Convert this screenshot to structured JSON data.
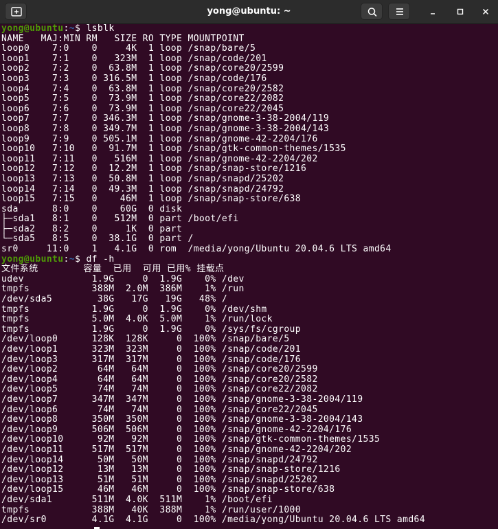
{
  "window": {
    "title": "yong@ubuntu: ~"
  },
  "icons": {
    "new_tab": "new-tab-icon",
    "search": "search-icon",
    "menu": "hamburger-menu-icon",
    "minimize": "minimize-icon",
    "maximize": "maximize-icon",
    "close": "close-icon"
  },
  "colors": {
    "background": "#300a24",
    "titlebar": "#2c2c2c",
    "prompt_user": "#4e9a06",
    "prompt_path": "#3465a4",
    "text": "#ffffff"
  },
  "terminal": {
    "prompt1": {
      "user_host": "yong@ubuntu",
      "sep": ":",
      "path": "~",
      "symbol": "$ ",
      "command": "lsblk"
    },
    "lsblk_lines": [
      "NAME   MAJ:MIN RM   SIZE RO TYPE MOUNTPOINT",
      "loop0    7:0    0     4K  1 loop /snap/bare/5",
      "loop1    7:1    0   323M  1 loop /snap/code/201",
      "loop2    7:2    0  63.8M  1 loop /snap/core20/2599",
      "loop3    7:3    0 316.5M  1 loop /snap/code/176",
      "loop4    7:4    0  63.8M  1 loop /snap/core20/2582",
      "loop5    7:5    0  73.9M  1 loop /snap/core22/2082",
      "loop6    7:6    0  73.9M  1 loop /snap/core22/2045",
      "loop7    7:7    0 346.3M  1 loop /snap/gnome-3-38-2004/119",
      "loop8    7:8    0 349.7M  1 loop /snap/gnome-3-38-2004/143",
      "loop9    7:9    0 505.1M  1 loop /snap/gnome-42-2204/176",
      "loop10   7:10   0  91.7M  1 loop /snap/gtk-common-themes/1535",
      "loop11   7:11   0   516M  1 loop /snap/gnome-42-2204/202",
      "loop12   7:12   0  12.2M  1 loop /snap/snap-store/1216",
      "loop13   7:13   0  50.8M  1 loop /snap/snapd/25202",
      "loop14   7:14   0  49.3M  1 loop /snap/snapd/24792",
      "loop15   7:15   0    46M  1 loop /snap/snap-store/638",
      "sda      8:0    0    60G  0 disk",
      "├─sda1   8:1    0   512M  0 part /boot/efi",
      "├─sda2   8:2    0     1K  0 part",
      "└─sda5   8:5    0  38.1G  0 part /",
      "sr0     11:0    1   4.1G  0 rom  /media/yong/Ubuntu 20.04.6 LTS amd64"
    ],
    "prompt2": {
      "user_host": "yong@ubuntu",
      "sep": ":",
      "path": "~",
      "symbol": "$ ",
      "command": "df -h"
    },
    "df_lines": [
      "文件系统        容量  已用  可用 已用% 挂载点",
      "udev            1.9G     0  1.9G    0% /dev",
      "tmpfs           388M  2.0M  386M    1% /run",
      "/dev/sda5        38G   17G   19G   48% /",
      "tmpfs           1.9G     0  1.9G    0% /dev/shm",
      "tmpfs           5.0M  4.0K  5.0M    1% /run/lock",
      "tmpfs           1.9G     0  1.9G    0% /sys/fs/cgroup",
      "/dev/loop0      128K  128K     0  100% /snap/bare/5",
      "/dev/loop1      323M  323M     0  100% /snap/code/201",
      "/dev/loop3      317M  317M     0  100% /snap/code/176",
      "/dev/loop2       64M   64M     0  100% /snap/core20/2599",
      "/dev/loop4       64M   64M     0  100% /snap/core20/2582",
      "/dev/loop5       74M   74M     0  100% /snap/core22/2082",
      "/dev/loop7      347M  347M     0  100% /snap/gnome-3-38-2004/119",
      "/dev/loop6       74M   74M     0  100% /snap/core22/2045",
      "/dev/loop8      350M  350M     0  100% /snap/gnome-3-38-2004/143",
      "/dev/loop9      506M  506M     0  100% /snap/gnome-42-2204/176",
      "/dev/loop10      92M   92M     0  100% /snap/gtk-common-themes/1535",
      "/dev/loop11     517M  517M     0  100% /snap/gnome-42-2204/202",
      "/dev/loop14      50M   50M     0  100% /snap/snapd/24792",
      "/dev/loop12      13M   13M     0  100% /snap/snap-store/1216",
      "/dev/loop13      51M   51M     0  100% /snap/snapd/25202",
      "/dev/loop15      46M   46M     0  100% /snap/snap-store/638",
      "/dev/sda1       511M  4.0K  511M    1% /boot/efi",
      "tmpfs           388M   40K  388M    1% /run/user/1000",
      "/dev/sr0        4.1G  4.1G     0  100% /media/yong/Ubuntu 20.04.6 LTS amd64"
    ]
  }
}
